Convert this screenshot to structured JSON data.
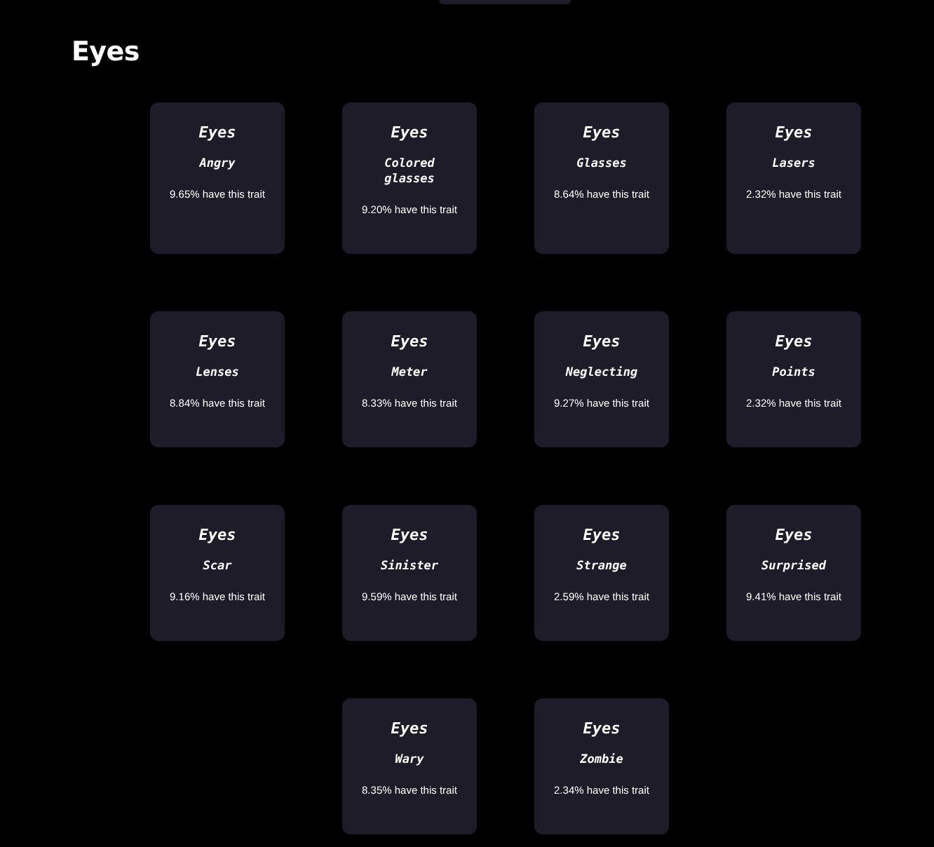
{
  "heading": "Eyes",
  "traits": [
    {
      "category": "Eyes",
      "name": "Angry",
      "share": "9.65% have this trait"
    },
    {
      "category": "Eyes",
      "name": "Colored glasses",
      "share": "9.20% have this trait"
    },
    {
      "category": "Eyes",
      "name": "Glasses",
      "share": "8.64% have this trait"
    },
    {
      "category": "Eyes",
      "name": "Lasers",
      "share": "2.32% have this trait"
    },
    {
      "category": "Eyes",
      "name": "Lenses",
      "share": "8.84% have this trait"
    },
    {
      "category": "Eyes",
      "name": "Meter",
      "share": "8.33% have this trait"
    },
    {
      "category": "Eyes",
      "name": "Neglecting",
      "share": "9.27% have this trait"
    },
    {
      "category": "Eyes",
      "name": "Points",
      "share": "2.32% have this trait"
    },
    {
      "category": "Eyes",
      "name": "Scar",
      "share": "9.16% have this trait"
    },
    {
      "category": "Eyes",
      "name": "Sinister",
      "share": "9.59% have this trait"
    },
    {
      "category": "Eyes",
      "name": "Strange",
      "share": "2.59% have this trait"
    },
    {
      "category": "Eyes",
      "name": "Surprised",
      "share": "9.41% have this trait"
    },
    {
      "category": "Eyes",
      "name": "Wary",
      "share": "8.35% have this trait"
    },
    {
      "category": "Eyes",
      "name": "Zombie",
      "share": "2.34% have this trait"
    }
  ]
}
